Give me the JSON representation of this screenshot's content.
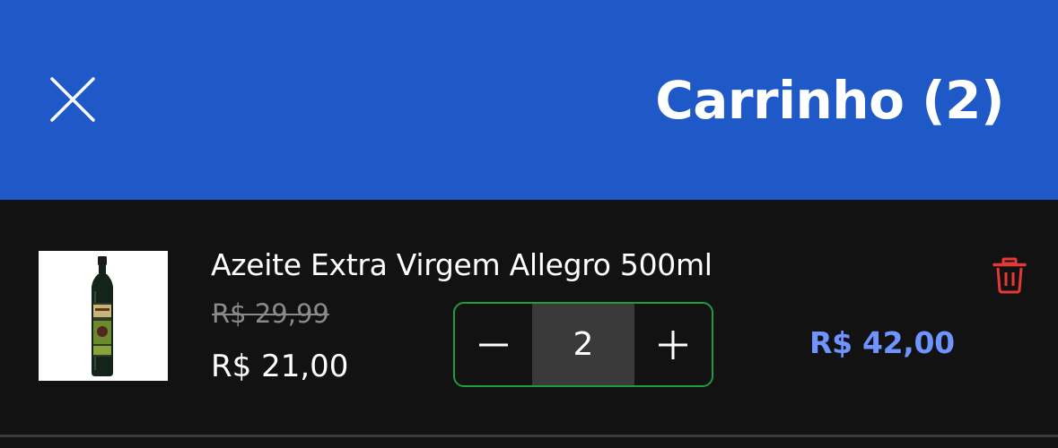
{
  "header": {
    "title": "Carrinho (2)",
    "close_icon": "close-icon",
    "background_color": "#1f59c7"
  },
  "cart": {
    "items": [
      {
        "name": "Azeite Extra Virgem Allegro 500ml",
        "old_price": "R$ 29,99",
        "price": "R$ 21,00",
        "quantity": "2",
        "line_total": "R$ 42,00",
        "decrease_icon": "minus-icon",
        "increase_icon": "plus-icon",
        "remove_icon": "trash-icon"
      }
    ]
  },
  "colors": {
    "accent_price": "#6f93ff",
    "stepper_border": "#1e9d3f",
    "remove": "#e53935"
  }
}
